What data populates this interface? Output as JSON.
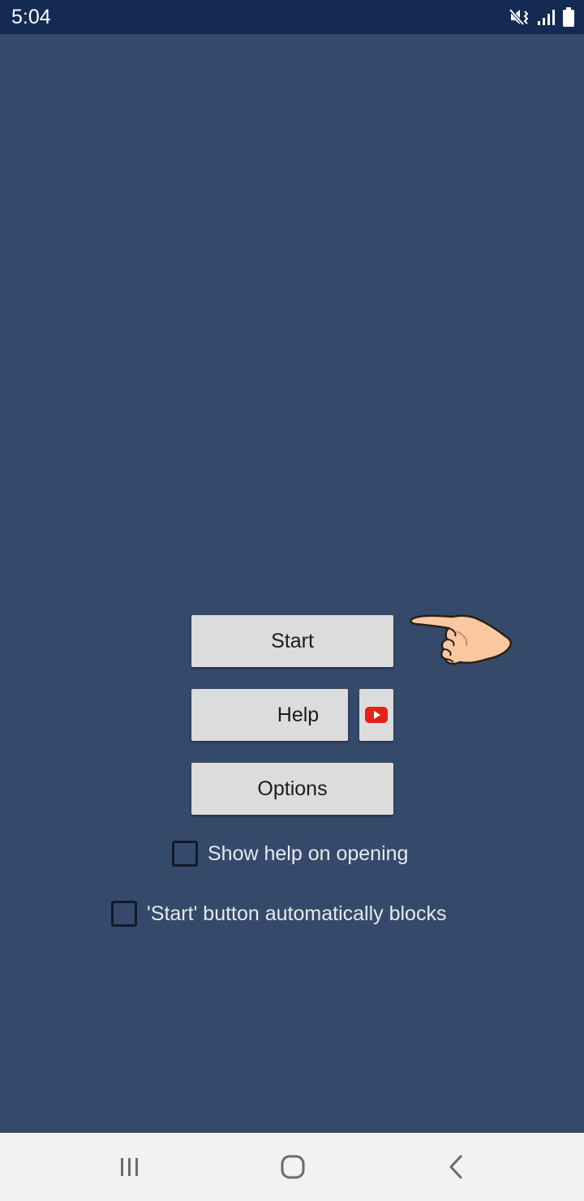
{
  "status_bar": {
    "time": "5:04",
    "icons": [
      "mute-vibrate-icon",
      "signal-icon",
      "battery-icon"
    ]
  },
  "buttons": {
    "start": "Start",
    "help": "Help",
    "video_icon": "youtube-icon",
    "options": "Options"
  },
  "checkboxes": [
    {
      "label": "Show help on opening",
      "checked": false
    },
    {
      "label": "'Start' button automatically blocks",
      "checked": false
    }
  ],
  "nav_bar": {
    "icons": [
      "recents-icon",
      "home-icon",
      "back-icon"
    ]
  },
  "colors": {
    "background": "#354a6a",
    "status_bar": "#142a52",
    "button": "#dcdcdc",
    "nav_bar": "#f2f2f2",
    "youtube_red": "#e62117",
    "hand_skin": "#f9c8a0"
  }
}
